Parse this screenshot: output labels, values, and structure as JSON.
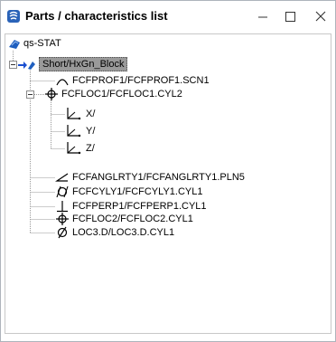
{
  "window": {
    "title": "Parts / characteristics list",
    "controls": [
      "minimize",
      "maximize",
      "close"
    ]
  },
  "tree": {
    "root": {
      "label": "qs-STAT",
      "icon": "database-icon"
    },
    "part": {
      "label": "Short/HxGn_Block",
      "icon": "probe-arrow-icon",
      "selected": true,
      "expanded": true
    },
    "items": [
      {
        "label": "FCFPROF1/FCFPROF1.SCN1",
        "icon": "profile-of-line-icon"
      },
      {
        "label": "FCFLOC1/FCFLOC1.CYL2",
        "icon": "position-icon",
        "expanded": true
      },
      {
        "label": "X/",
        "icon": "axis-icon"
      },
      {
        "label": "Y/",
        "icon": "axis-icon"
      },
      {
        "label": "Z/",
        "icon": "axis-icon"
      },
      {
        "label": "FCFANGLRTY1/FCFANGLRTY1.PLN5",
        "icon": "angularity-icon"
      },
      {
        "label": "FCFCYLY1/FCFCYLY1.CYL1",
        "icon": "cylindricity-icon"
      },
      {
        "label": "FCFPERP1/FCFPERP1.CYL1",
        "icon": "perpendicularity-icon"
      },
      {
        "label": "FCFLOC2/FCFLOC2.CYL1",
        "icon": "position-icon"
      },
      {
        "label": "LOC3.D/LOC3.D.CYL1",
        "icon": "diameter-icon"
      }
    ]
  }
}
